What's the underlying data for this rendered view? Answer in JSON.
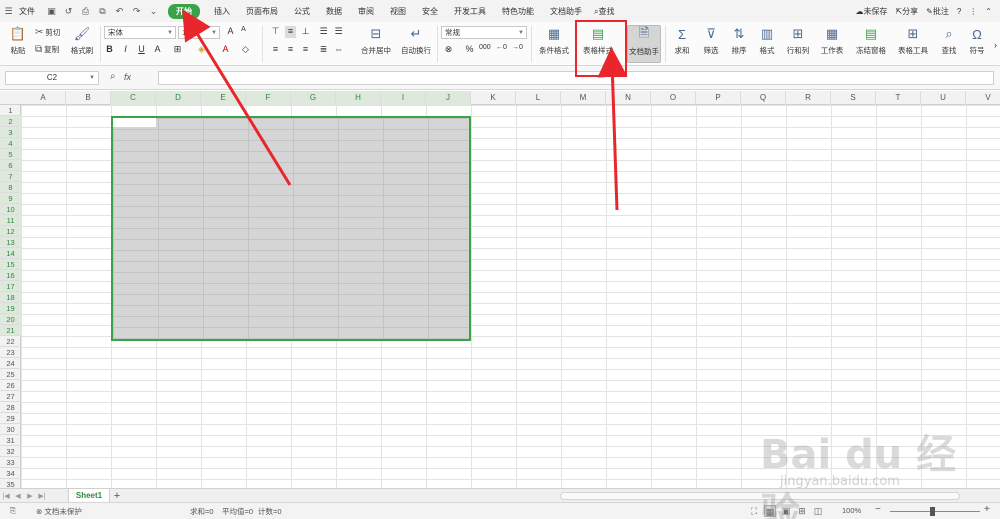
{
  "menubar": {
    "file": "文件",
    "tabs": [
      "开始",
      "插入",
      "页面布局",
      "公式",
      "数据",
      "审阅",
      "视图",
      "安全",
      "开发工具",
      "特色功能",
      "文档助手"
    ],
    "active_tab": "开始",
    "search": "查找",
    "unsaved": "未保存",
    "share": "分享",
    "comment": "批注",
    "help": "?"
  },
  "ribbon": {
    "paste": "粘贴",
    "cut": "剪切",
    "copy": "复制",
    "format_painter": "格式刷",
    "font_name": "宋体",
    "font_size": "11",
    "bold": "B",
    "italic": "I",
    "underline": "U",
    "merge_center": "合并居中",
    "wrap_text": "自动换行",
    "number_format": "常规",
    "percent": "%",
    "conditional_format": "条件格式",
    "table_style": "表格样式",
    "doc_assistant": "文档助手",
    "sum": "求和",
    "filter": "筛选",
    "sort": "排序",
    "format": "格式",
    "row_col": "行和列",
    "worksheet": "工作表",
    "freeze": "冻结窗格",
    "table_tools": "表格工具",
    "find": "查找",
    "symbol": "符号"
  },
  "formula_bar": {
    "name_box": "C2",
    "fx": "fx"
  },
  "grid": {
    "columns": [
      "A",
      "B",
      "C",
      "D",
      "E",
      "F",
      "G",
      "H",
      "I",
      "J",
      "K",
      "L",
      "M",
      "N",
      "O",
      "P",
      "Q",
      "R",
      "S",
      "T",
      "U",
      "V"
    ],
    "selected_columns": [
      "C",
      "D",
      "E",
      "F",
      "G",
      "H",
      "I",
      "J"
    ],
    "rows": [
      "1",
      "2",
      "3",
      "4",
      "5",
      "6",
      "7",
      "8",
      "9",
      "10",
      "11",
      "12",
      "13",
      "14",
      "15",
      "16",
      "17",
      "18",
      "19",
      "20",
      "21",
      "22",
      "23",
      "24",
      "25",
      "26",
      "27",
      "28",
      "29",
      "30",
      "31",
      "32",
      "33",
      "34",
      "35"
    ],
    "selected_rows_from": 2,
    "selected_rows_to": 21
  },
  "sheets": {
    "tabs": [
      "Sheet1"
    ],
    "add": "+"
  },
  "statusbar": {
    "protect": "文档未保护",
    "sum": "求和=0",
    "average": "平均值=0",
    "count": "计数=0",
    "zoom": "100%",
    "minus": "−",
    "plus": "+"
  },
  "watermark": {
    "brand": "Bai du 经验",
    "url": "jingyan.baidu.com"
  },
  "colors": {
    "accent": "#3aa348",
    "annotation": "#e8262b",
    "selection_fill": "#d5d5d5"
  }
}
